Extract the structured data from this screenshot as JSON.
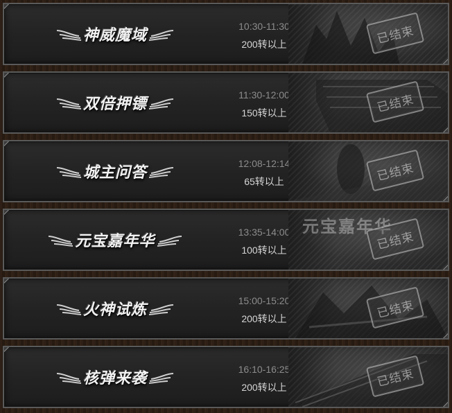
{
  "events": [
    {
      "name": "神威魔域",
      "time": "10:30-11:30",
      "requirement": "200转以上",
      "status": "已结束",
      "art_text": ""
    },
    {
      "name": "双倍押镖",
      "time": "11:30-12:00",
      "requirement": "150转以上",
      "status": "已结束",
      "art_text": ""
    },
    {
      "name": "城主问答",
      "time": "12:08-12:14",
      "requirement": "65转以上",
      "status": "已结束",
      "art_text": ""
    },
    {
      "name": "元宝嘉年华",
      "time": "13:35-14:00",
      "requirement": "100转以上",
      "status": "已结束",
      "art_text": "元宝嘉年华"
    },
    {
      "name": "火神试炼",
      "time": "15:00-15:20",
      "requirement": "200转以上",
      "status": "已结束",
      "art_text": ""
    },
    {
      "name": "核弹来袭",
      "time": "16:10-16:25",
      "requirement": "200转以上",
      "status": "已结束",
      "art_text": ""
    }
  ]
}
